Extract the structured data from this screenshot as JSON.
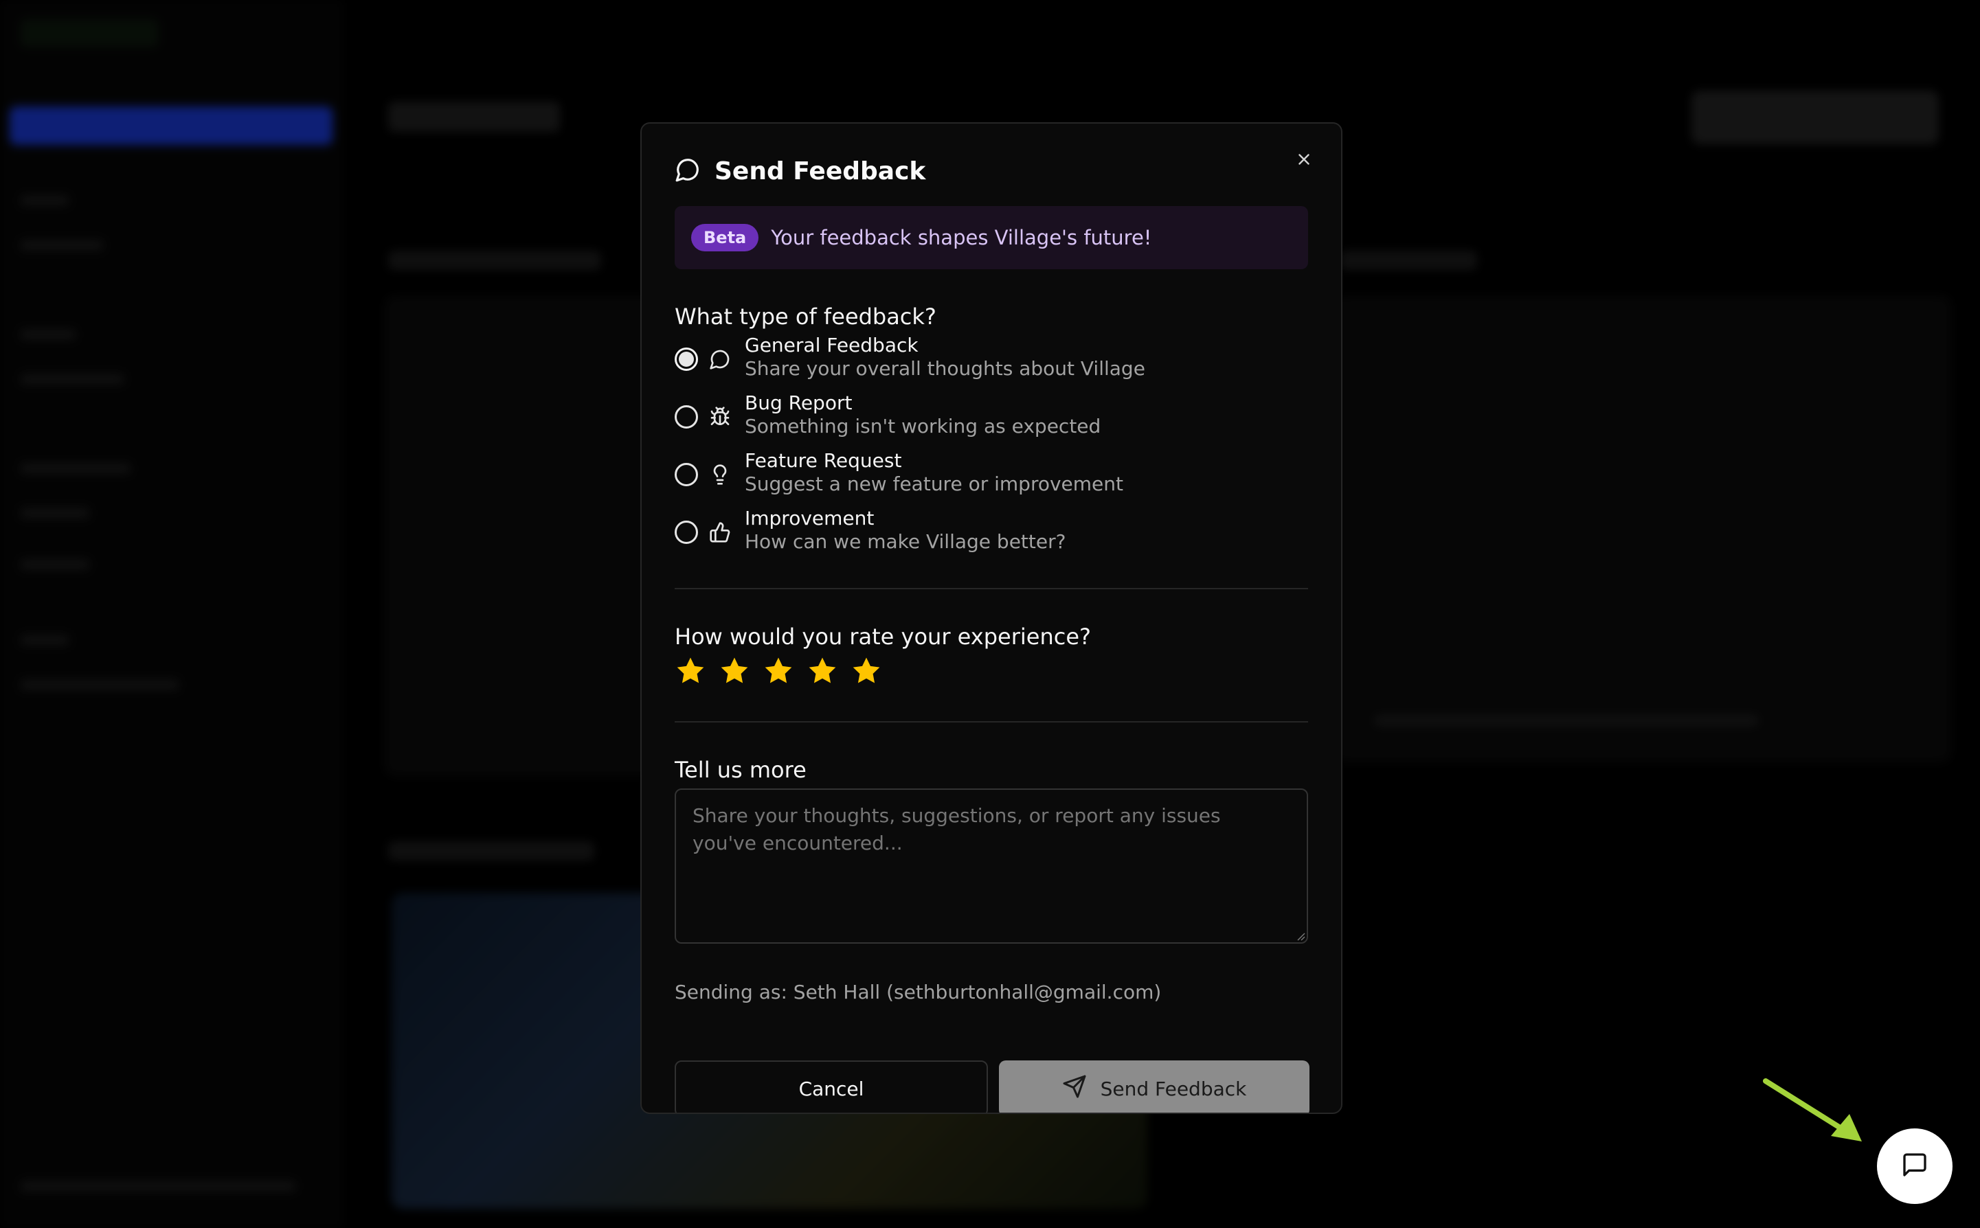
{
  "modal": {
    "title": "Send Feedback",
    "beta_badge": "Beta",
    "beta_message": "Your feedback shapes Village's future!",
    "type_question": "What type of feedback?",
    "types": [
      {
        "title": "General Feedback",
        "description": "Share your overall thoughts about Village",
        "icon": "message-circle-icon",
        "selected": true
      },
      {
        "title": "Bug Report",
        "description": "Something isn't working as expected",
        "icon": "bug-icon",
        "selected": false
      },
      {
        "title": "Feature Request",
        "description": "Suggest a new feature or improvement",
        "icon": "lightbulb-icon",
        "selected": false
      },
      {
        "title": "Improvement",
        "description": "How can we make Village better?",
        "icon": "thumbs-up-icon",
        "selected": false
      }
    ],
    "rating_question": "How would you rate your experience?",
    "rating": {
      "value": 5,
      "max": 5,
      "star_color": "#FFC400"
    },
    "details_label": "Tell us more",
    "details_placeholder": "Share your thoughts, suggestions, or report any issues you've encountered...",
    "details_value": "",
    "sending_as": "Sending as: Seth Hall (sethburtonhall@gmail.com)",
    "cancel_label": "Cancel",
    "send_label": "Send Feedback"
  },
  "floating_button": {
    "icon": "message-square-icon"
  },
  "annotation": {
    "arrow_color": "#A3D33A"
  }
}
